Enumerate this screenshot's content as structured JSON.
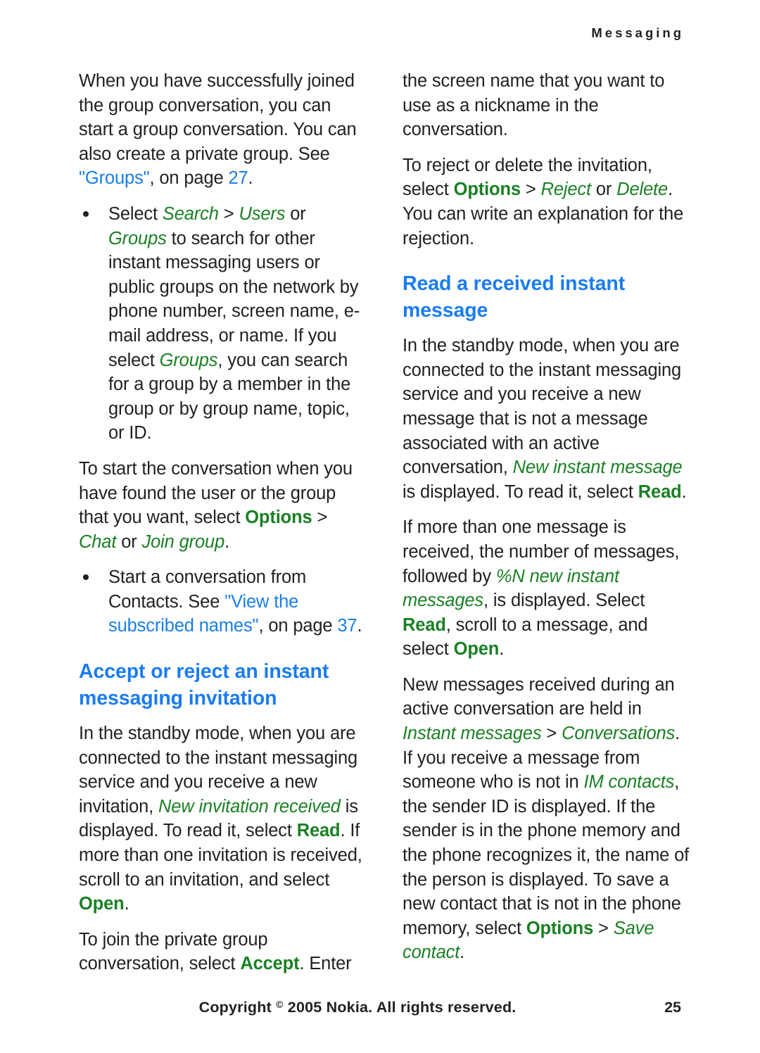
{
  "header": {
    "running_title": "Messaging"
  },
  "colors": {
    "heading_blue": "#1a7cf0",
    "link_blue": "#1a7ee8",
    "ui_green": "#1a8024",
    "body_black": "#231f20"
  },
  "left_column": {
    "paragraph_1": {
      "t1": "When you have successfully joined the group conversation, you can start a group conversation. You can also create a private group. See ",
      "q1": "\"Groups\"",
      "t2": ", on page ",
      "p1": "27",
      "t3": "."
    },
    "bullet_1": {
      "t1": "Select ",
      "ui1": "Search",
      "sep1": " > ",
      "ui2": "Users",
      "t2": " or ",
      "ui3": "Groups",
      "t3": " to search for other instant messaging users or public groups on the network by phone number, screen name, e-mail address, or name. If you select ",
      "ui4": "Groups",
      "t4": ", you can search for a group by a member in the group or by group name, topic, or ID."
    },
    "paragraph_2": {
      "t1": "To start the conversation when you have found the user or the group that you want, select ",
      "ui1": "Options",
      "sep1": " > ",
      "ui2": "Chat",
      "t2": " or ",
      "ui3": "Join group",
      "t3": "."
    },
    "bullet_2": {
      "t1": "Start a conversation from Contacts. See ",
      "q1": "\"View the subscribed names\"",
      "t2": ", on page ",
      "p1": "37",
      "t3": "."
    },
    "heading_1": "Accept or reject an instant messaging invitation",
    "paragraph_3": {
      "t1": "In the standby mode, when you are connected to the instant messaging service and you receive a new invitation, ",
      "ui1": "New invitation received",
      "t2": " is displayed. To read it, select ",
      "ui2": "Read",
      "t3": ". If more than one invitation is received, scroll to an invitation, and select ",
      "ui3": "Open",
      "t4": "."
    },
    "paragraph_4": {
      "t1": "To join the private group conversation, select ",
      "ui1": "Accept",
      "t2": ". Enter"
    }
  },
  "right_column": {
    "paragraph_1": "the screen name that you want to use as a nickname in the conversation.",
    "paragraph_2": {
      "t1": "To reject or delete the invitation, select ",
      "ui1": "Options",
      "sep1": " > ",
      "ui2": "Reject",
      "t2": " or ",
      "ui3": "Delete",
      "t3": ". You can write an explanation for the rejection."
    },
    "heading_1": "Read a received instant message",
    "paragraph_3": {
      "t1": "In the standby mode, when you are connected to the instant messaging service and you receive a new message that is not a message associated with an active conversation, ",
      "ui1": "New instant message",
      "t2": " is displayed. To read it, select ",
      "ui2": "Read",
      "t3": "."
    },
    "paragraph_4": {
      "t1": "If more than one message is received, the number of messages, followed by ",
      "ui1": "%N new instant messages",
      "t2": ", is displayed. Select ",
      "ui2": "Read",
      "t3": ", scroll to a message, and select ",
      "ui3": "Open",
      "t4": "."
    },
    "paragraph_5": {
      "t1": "New messages received during an active conversation are held in ",
      "ui1": "Instant messages",
      "sep1": " > ",
      "ui2": "Conversations",
      "t2": ". If you receive a message from someone who is not in ",
      "ui3": "IM contacts",
      "t3": ", the sender ID is displayed. If the sender is in the phone memory and the phone recognizes it, the name of the person is displayed. To save a new contact that is not in the phone memory, select ",
      "ui4": "Options",
      "sep2": " > ",
      "ui5": "Save contact",
      "t4": "."
    }
  },
  "footer": {
    "copyright_prefix": "Copyright ",
    "copyright_symbol": "©",
    "copyright_suffix": " 2005 Nokia. All rights reserved.",
    "page_number": "25"
  }
}
